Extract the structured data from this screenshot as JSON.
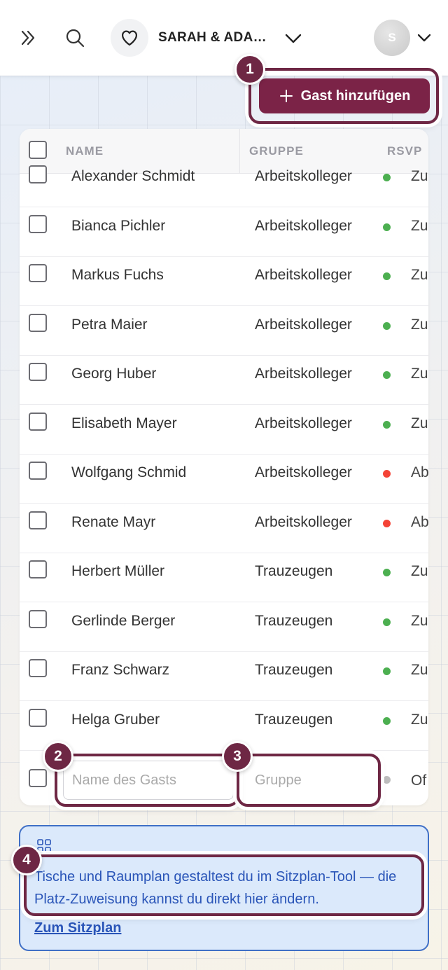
{
  "header": {
    "event_name": "SARAH & ADAM...",
    "avatar_initial": "S"
  },
  "actions": {
    "add_guest_label": "Gast hinzufügen"
  },
  "badges": [
    "1",
    "2",
    "3",
    "4"
  ],
  "table": {
    "columns": [
      "NAME",
      "GRUPPE",
      "RSVP"
    ],
    "rows": [
      {
        "name": "Alexander Schmidt",
        "group": "Arbeitskolleger",
        "rsvp": "Zu",
        "status": "accepted"
      },
      {
        "name": "Bianca Pichler",
        "group": "Arbeitskolleger",
        "rsvp": "Zu",
        "status": "accepted"
      },
      {
        "name": "Markus Fuchs",
        "group": "Arbeitskolleger",
        "rsvp": "Zu",
        "status": "accepted"
      },
      {
        "name": "Petra Maier",
        "group": "Arbeitskolleger",
        "rsvp": "Zu",
        "status": "accepted"
      },
      {
        "name": "Georg Huber",
        "group": "Arbeitskolleger",
        "rsvp": "Zu",
        "status": "accepted"
      },
      {
        "name": "Elisabeth Mayer",
        "group": "Arbeitskolleger",
        "rsvp": "Zu",
        "status": "accepted"
      },
      {
        "name": "Wolfgang Schmid",
        "group": "Arbeitskolleger",
        "rsvp": "Ab",
        "status": "declined"
      },
      {
        "name": "Renate Mayr",
        "group": "Arbeitskolleger",
        "rsvp": "Ab",
        "status": "declined"
      },
      {
        "name": "Herbert Müller",
        "group": "Trauzeugen",
        "rsvp": "Zu",
        "status": "accepted"
      },
      {
        "name": "Gerlinde Berger",
        "group": "Trauzeugen",
        "rsvp": "Zu",
        "status": "accepted"
      },
      {
        "name": "Franz Schwarz",
        "group": "Trauzeugen",
        "rsvp": "Zu",
        "status": "accepted"
      },
      {
        "name": "Helga Gruber",
        "group": "Trauzeugen",
        "rsvp": "Zu",
        "status": "accepted"
      }
    ],
    "new_row": {
      "name_placeholder": "Name des Gasts",
      "group_placeholder": "Gruppe",
      "rsvp": "Of"
    }
  },
  "info": {
    "text": "Tische und Raumplan gestaltest du im Sitzplan-Tool — die Platz-Zuweisung kannst du direkt hier ändern.",
    "link": "Zum Sitzplan"
  },
  "colors": {
    "accent": "#7b2347",
    "highlight": "#6e2744",
    "accepted": "#4caf50",
    "declined": "#f44336",
    "pending": "#bdbdbd",
    "info_bg": "#dbe9fb",
    "info_text": "#2a55b8"
  },
  "icons": [
    "expand-icon",
    "search-icon",
    "heart-icon",
    "chevron-down-icon",
    "plus-icon",
    "grid-icon"
  ]
}
